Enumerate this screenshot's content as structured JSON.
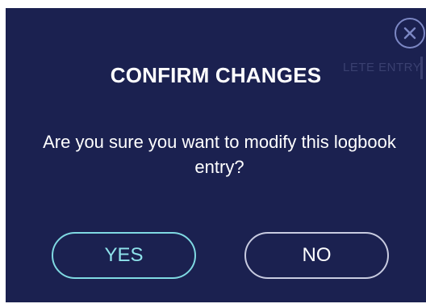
{
  "dialog": {
    "background_label": "LETE ENTRY",
    "title": "CONFIRM CHANGES",
    "message": "Are you sure you want to modify this logbook entry?",
    "close_icon": "close-icon",
    "buttons": {
      "yes_label": "YES",
      "no_label": "NO"
    }
  },
  "colors": {
    "dialog_background": "#1b2150",
    "yes_accent": "#7fd9e2",
    "no_outline": "#c8cbe0",
    "close_icon": "#7c87c4"
  }
}
